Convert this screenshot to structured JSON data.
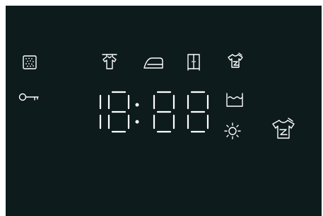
{
  "display": {
    "digits": [
      "1",
      "8",
      "8",
      "8"
    ],
    "digit_values": [
      1,
      8,
      8,
      8
    ],
    "colon": true,
    "color": "#ffffff",
    "background": "#0d1b1c"
  },
  "icons": [
    "drum-clean-icon",
    "child-lock-key-icon",
    "hanging-shirt-icon",
    "iron-icon",
    "cupboard-icon",
    "shirt-crease-icon",
    "water-tub-icon",
    "sun-dry-icon",
    "large-shirt-crease-icon"
  ]
}
